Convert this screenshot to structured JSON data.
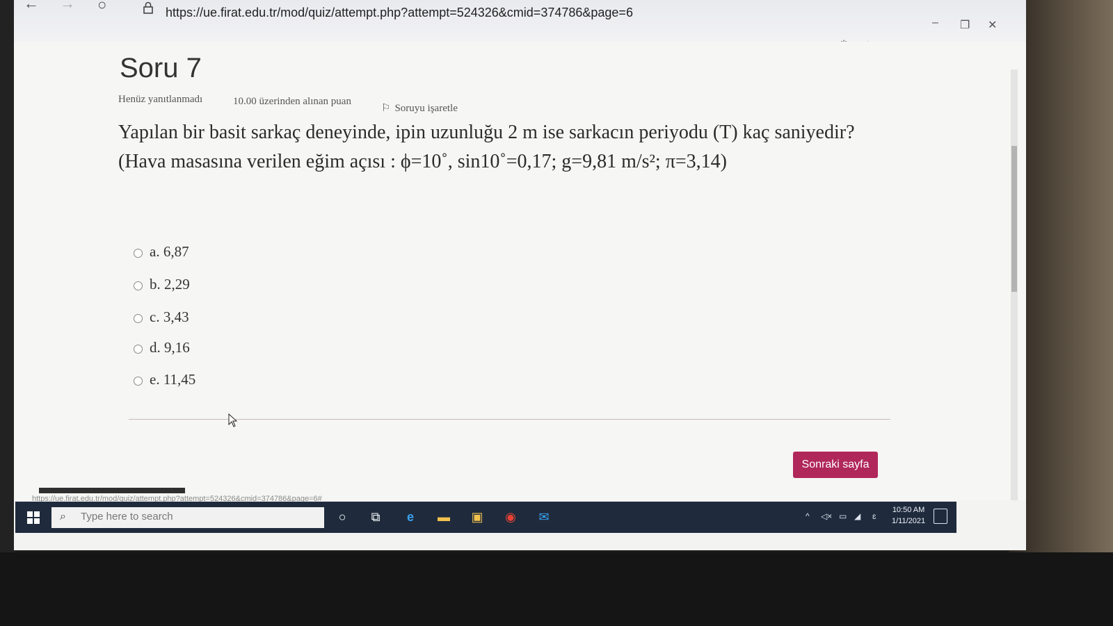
{
  "browser": {
    "url": "https://ue.firat.edu.tr/mod/quiz/attempt.php?attempt=524326&cmid=374786&page=6"
  },
  "question": {
    "title": "Soru 7",
    "status": "Henüz yanıtlanmadı",
    "points": "10.00 üzerinden alınan puan",
    "flag_label": "Soruyu işaretle",
    "text_line1": "Yapılan bir basit sarkaç deneyinde, ipin uzunluğu 2 m ise sarkacın periyodu (T) kaç saniyedir?",
    "text_line2": "(Hava masasına verilen eğim açısı : ϕ=10˚, sin10˚=0,17; g=9,81 m/s²; π=3,14)",
    "options": [
      {
        "label": "a. 6,87"
      },
      {
        "label": "b. 2,29"
      },
      {
        "label": "c. 3,43"
      },
      {
        "label": "d. 9,16"
      },
      {
        "label": "e. 11,45"
      }
    ],
    "next_label": "Sonraki sayfa"
  },
  "status_bar_url": "https://ue.firat.edu.tr/mod/quiz/attempt.php?attempt=524326&cmid=374786&page=6#",
  "taskbar": {
    "search_placeholder": "Type here to search",
    "time": "10:50 AM",
    "date": "1/11/2021"
  },
  "colors": {
    "primary_button": "#b0275a",
    "taskbar": "#1f2b3d"
  }
}
